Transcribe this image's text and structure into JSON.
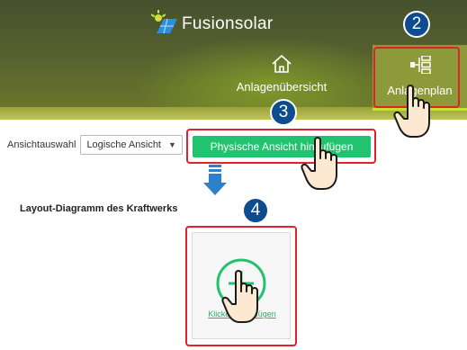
{
  "header": {
    "app_name": "Fusionsolar",
    "nav": {
      "home_label": "Anlagenübersicht",
      "plan_label": "Anlagenplan"
    }
  },
  "toolbar": {
    "view_label": "Ansichtauswahl",
    "view_select_value": "Logische Ansicht",
    "add_physical_button": "Physische Ansicht hinzufügen"
  },
  "diagram": {
    "title": "Layout-Diagramm des Kraftwerks",
    "add_card_link": "Klicken hinzufügen"
  },
  "steps": [
    "2",
    "3",
    "4"
  ],
  "colors": {
    "accent_green": "#21c36f",
    "highlight_red": "#e0232b",
    "badge_blue": "#0d4c8f",
    "header_olive": "#56602f"
  }
}
